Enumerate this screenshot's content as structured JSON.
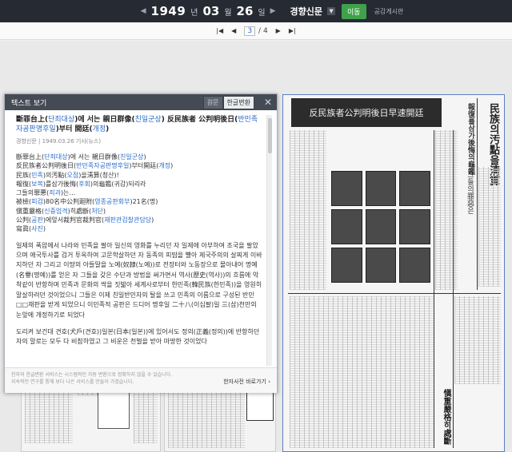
{
  "topbar": {
    "year": "1949",
    "month": "03",
    "day": "26",
    "unit_year": "년",
    "unit_month": "월",
    "unit_day": "일",
    "paper": "경향신문",
    "go_label": "이동",
    "notice": "공감게시판"
  },
  "pagebar": {
    "current": "3",
    "total": "/ 4"
  },
  "panel": {
    "title": "텍스트 보기",
    "seg_original": "원문",
    "seg_hangul": "한글변환",
    "article_title_1": "斷罪台上(",
    "article_title_1g": "단죄대상",
    "article_title_2": ")에 서는 親日群像(",
    "article_title_2g": "친일군상",
    "article_title_3": ") 反民族者 公判明後日(",
    "article_title_3g": "반민족자공판명후일",
    "article_title_4": ")부터 開廷(",
    "article_title_4g": "개정",
    "article_title_5": ")",
    "meta": "경향신문 | 1949.03.26 기사(뉴스)",
    "lines": [
      {
        "a": "斷罪台上(",
        "g": "단죄대상",
        "b": ")에 서는 親日群像(",
        "g2": "친일군상",
        "c": ")"
      },
      {
        "a": "反民族者公判明後日(",
        "g": "반민족자공판명후일",
        "b": ")부터開廷(",
        "g2": "개정",
        "c": ")"
      },
      {
        "a": "民族(",
        "g": "민족",
        "b": ")의汚點(",
        "g2": "오점",
        "c": ")을淸算(청산)!"
      },
      {
        "a": "報復(",
        "g": "보복",
        "b": ")를삼가後悔(",
        "g2": "후회",
        "c": ")의龜鑑(귀감)되리라"
      },
      {
        "a": "그들의罪悪(",
        "g": "죄과",
        "b": ")는…",
        "g2": "",
        "c": ""
      },
      {
        "a": "被檢(",
        "g": "피검",
        "b": ")80名中公判廻附(",
        "g2": "영종공판회부",
        "c": ")21名(명)"
      },
      {
        "a": "愼重嚴格(",
        "g": "신중엄격",
        "b": ")히處斷(",
        "g2": "처단",
        "c": ")"
      },
      {
        "a": "公判(",
        "g": "공판",
        "b": ")에앞서裁判官裁判官(",
        "g2": "재판관검찰관담당",
        "c": ")"
      },
      {
        "a": "寫眞(",
        "g": "사진",
        "b": ")",
        "g2": "",
        "c": ""
      }
    ],
    "para1": "일제의 폭압에서 나라와 민족을 팔아 일신의 영화를 누리던 자 일제에 아부하여 조국을 팔았으며 애국투사를 검거 투옥하여 고문학살하던 자 동족의 피땀을 빨아 제국주의의 살찌게 이바지하던 자 그리고 이땅의 아들딸을 노예(奴隷(노예))로 전장터와 노동장으로 몰아내어 명예(名譽(명예))를 얻은 자 그들을 갖은 수단과 방법을 써가면서 역사(歷史(역사))의 흐름에 악착같이 반항하며 민족과 문화의 싹을 짓밟아 세계사로부터 한민족(韓民族(한민족))을 영원히 말살하려던 것이었으니 그들은 이제 친일반민자의 탈을 쓰고 민족의 이름으로 구성된 반민□□재판을 받게 되었으니 이민족적 공판은 드디어 명후일 二十八(이십팔)일 三(삼)천만의 눈앞에 개정하기로 되었다",
    "para2": "도리켜 보건대 견호(犬戶(견호))일본(日本(일본))에 있어서도 정의(正義(정의))에 반항하던 자의 말로는 모두 다 비참하였고 그 비운은 천벌을 받아 마땅한 것이었다",
    "foot_note_1": "한자의 한글변환 서비스는 시스템적인 자동 변환으로 정확하지 않을 수 있습니다.",
    "foot_note_2": "지속적인 연구를 통해 보다 나은 서비스를 만들어 가겠습니다.",
    "foot_link": "한자사전 바로가기 ›"
  },
  "scan": {
    "headline": "反民族者公判明後日早速開廷",
    "side_title": "民族의汚點을淸算",
    "side_title2": "報復를삼가後悔의龜鑑",
    "mid_title": "그들의罪惡은",
    "bottom_title": "愼重嚴格히處斷"
  }
}
